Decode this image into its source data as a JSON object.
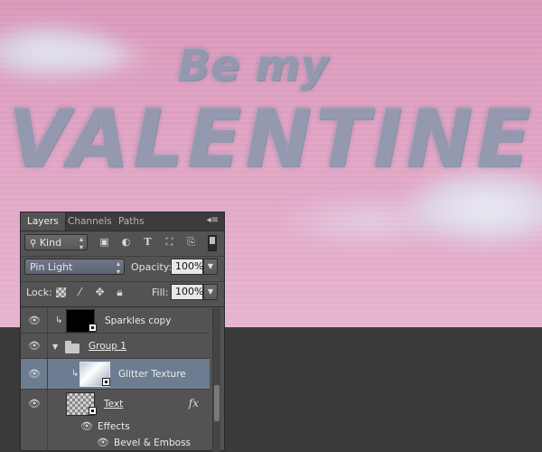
{
  "artwork": {
    "line1": "Be my",
    "line2": "VALENTINE"
  },
  "panel": {
    "tabs": [
      {
        "label": "Layers",
        "active": true
      },
      {
        "label": "Channels",
        "active": false
      },
      {
        "label": "Paths",
        "active": false
      }
    ],
    "filter": {
      "kind_label": "Kind",
      "icons": [
        "image-filter-icon",
        "adjustment-filter-icon",
        "type-filter-icon",
        "shape-filter-icon",
        "smart-object-filter-icon"
      ]
    },
    "blend_mode": "Pin Light",
    "opacity_label": "Opacity:",
    "opacity_value": "100%",
    "lock_label": "Lock:",
    "fill_label": "Fill:",
    "fill_value": "100%",
    "layers": [
      {
        "name": "Sparkles copy",
        "thumb": "black",
        "clipped": true,
        "visible": true
      },
      {
        "name": "Group 1",
        "type": "group",
        "visible": true,
        "expanded": true
      },
      {
        "name": "Glitter Texture",
        "thumb": "glitter",
        "clipped": true,
        "selected": true,
        "visible": true
      },
      {
        "name": "Text",
        "thumb": "text",
        "fx": "fx",
        "visible": true
      },
      {
        "name": "Effects",
        "type": "effects-header"
      },
      {
        "name": "Bevel & Emboss",
        "type": "effect"
      }
    ]
  },
  "colors": {
    "canvas_pink": "#dfa3c3",
    "panel_bg": "#535353",
    "selected_row": "#6d7c91"
  }
}
